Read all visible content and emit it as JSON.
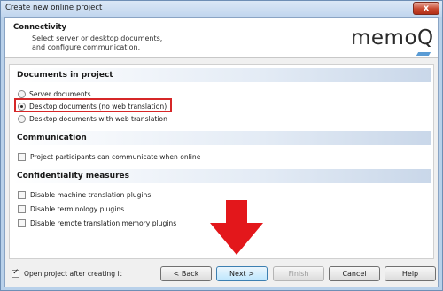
{
  "window": {
    "title": "Create new online project",
    "close_label": "x"
  },
  "header": {
    "title": "Connectivity",
    "description_line1": "Select server or desktop documents,",
    "description_line2": "and configure communication.",
    "logo_text": "memo",
    "logo_q": "Q"
  },
  "sections": {
    "documents": {
      "heading": "Documents in project",
      "options": [
        {
          "label": "Server documents",
          "selected": false
        },
        {
          "label": "Desktop documents (no web translation)",
          "selected": true
        },
        {
          "label": "Desktop documents with web translation",
          "selected": false
        }
      ]
    },
    "communication": {
      "heading": "Communication",
      "options": [
        {
          "label": "Project participants can communicate when online",
          "checked": false
        }
      ]
    },
    "confidentiality": {
      "heading": "Confidentiality measures",
      "options": [
        {
          "label": "Disable machine translation plugins",
          "checked": false
        },
        {
          "label": "Disable terminology plugins",
          "checked": false
        },
        {
          "label": "Disable remote translation memory plugins",
          "checked": false
        }
      ]
    }
  },
  "footer": {
    "open_after_label": "Open project after creating it",
    "open_after_checked": true,
    "back_label": "< Back",
    "next_label": "Next >",
    "finish_label": "Finish",
    "cancel_label": "Cancel",
    "help_label": "Help"
  },
  "colors": {
    "highlight": "#d62728",
    "arrow": "#e3171b",
    "logo_accent": "#5a9bd4"
  }
}
